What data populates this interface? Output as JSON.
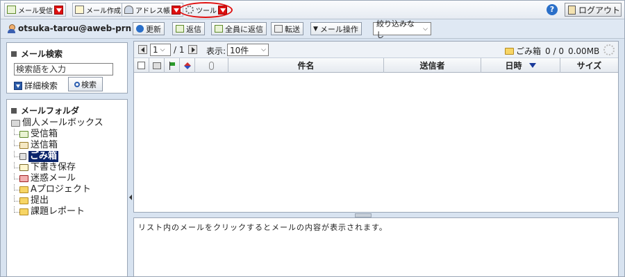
{
  "menubar": {
    "receive_label": "メール受信",
    "compose_label": "メール作成",
    "address_label": "アドレス帳",
    "tools_label": "ツール",
    "help_symbol": "?",
    "logout_label": "ログアウト"
  },
  "toolbar": {
    "account": "otsuka-tarou@aweb-prn",
    "refresh_label": "更新",
    "reply_label": "返信",
    "reply_all_label": "全員に返信",
    "forward_label": "転送",
    "mail_ops_label": "メール操作",
    "filter_label": "絞り込みなし"
  },
  "search": {
    "title": "メール検索",
    "placeholder": "検索語を入力",
    "advanced_label": "詳細検索",
    "button_label": "検索"
  },
  "folders": {
    "title": "メールフォルダ",
    "root": "個人メールボックス",
    "items": [
      {
        "label": "受信箱"
      },
      {
        "label": "送信箱"
      },
      {
        "label": "ごみ箱",
        "selected": true
      },
      {
        "label": "下書き保存"
      },
      {
        "label": "迷惑メール"
      },
      {
        "label": "Aプロジェクト"
      },
      {
        "label": "提出"
      },
      {
        "label": "課題レポート"
      }
    ]
  },
  "list": {
    "page_current": "1",
    "page_separator": "/ 1",
    "display_label": "表示:",
    "per_page": "10件",
    "folder_name": "ごみ箱",
    "counts": "0 / 0",
    "size": "0.00MB",
    "columns": {
      "subject": "件名",
      "sender": "送信者",
      "date": "日時",
      "size": "サイズ"
    },
    "rows": []
  },
  "preview": {
    "message": "リスト内のメールをクリックするとメールの内容が表示されます。"
  },
  "colors": {
    "accent_red": "#e01010",
    "selected_bg": "#0a246a",
    "pane_bg": "#d8e3f0"
  }
}
